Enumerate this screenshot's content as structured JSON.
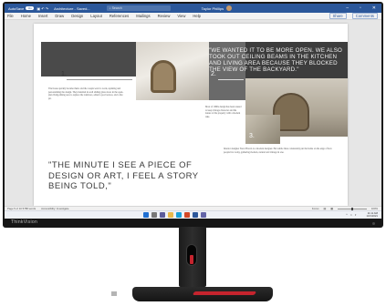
{
  "word": {
    "autosave_label": "AutoSave",
    "autosave_state": "On",
    "doc_title": "Architecture - Saved...",
    "search_placeholder": "Search",
    "user_name": "Taylor Phillips",
    "menus": [
      "File",
      "Home",
      "Insert",
      "Draw",
      "Design",
      "Layout",
      "References",
      "Mailings",
      "Review",
      "View",
      "Help"
    ],
    "share_label": "Share",
    "comments_label": "Comments"
  },
  "document": {
    "num1": "1.",
    "num2": "2.",
    "num3": "3.",
    "quote_top": "\"WE WANTED IT TO BE MORE OPEN. WE ALSO TOOK OUT CEILING BEAMS IN THE KITCHEN AND LIVING AREA BECAUSE THEY BLOCKED THE VIEW OF THE BACKYARD.\"",
    "pull_quote": "\"THE MINUTE I SEE A PIECE OF DESIGN OR ART, I FEEL A STORY BEING TOLD,\"",
    "col_left": "The house quickly became theirs and the couple went to work, updating and personalizing the design. They installed in-wall sliding glass doors in the open-plan living-dining area to replace the windows, added a pool terrace, and a fire pit.",
    "col_mid": "Most of 1960s design has been reused to keep vintage character and the nature of the property with a modern take.",
    "col_right": "Interior designer Steve Brown is a modern designer. Her subtle lines consistently put the home on the edge of how people live today, gathering modern, natural and vintage in one."
  },
  "statusbar": {
    "page_info": "Page 5 of 10   5788 words",
    "accessibility": "Accessibility: Investigate",
    "focus": "Focus",
    "zoom": "100%"
  },
  "taskbar": {
    "time": "11:11 AM",
    "date": "10/1/2021"
  },
  "brand": "ThinkVision",
  "colors": {
    "word_blue": "#2b579a",
    "lenovo_red": "#c5242e"
  }
}
